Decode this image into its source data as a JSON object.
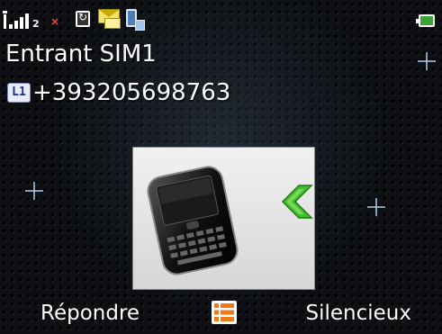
{
  "status_bar": {
    "signal_bars": 4,
    "sim_number": "2",
    "sim_status": "×",
    "icons": [
      "nfc-icon",
      "message-icon",
      "phone-status-icon",
      "battery-icon"
    ]
  },
  "call": {
    "title": "Entrant SIM1",
    "line_badge": "L1",
    "number": "+393205698763"
  },
  "softkeys": {
    "left": "Répondre",
    "center_icon": "menu-list-icon",
    "right": "Silencieux"
  },
  "colors": {
    "accent_green": "#3fbf2a",
    "menu_orange": "#f07a1a"
  }
}
